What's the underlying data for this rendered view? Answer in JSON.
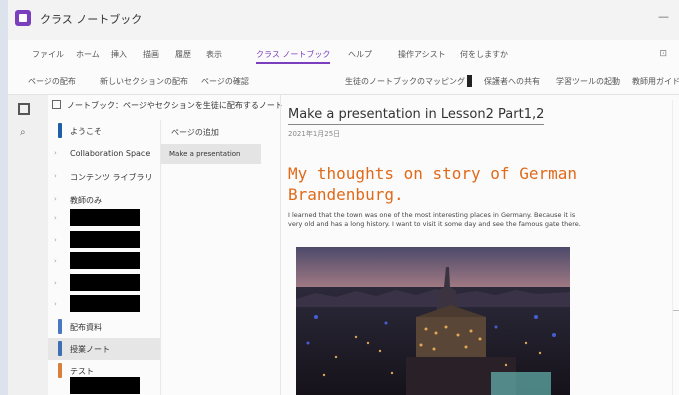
{
  "app": {
    "title": "クラス ノートブック",
    "window_controls": "—"
  },
  "ribbon": {
    "tabs": [
      "ファイル",
      "ホーム",
      "挿入",
      "描画",
      "履歴",
      "表示",
      "クラス ノートブック",
      "ヘルプ",
      "操作アシスト",
      "何をしますか"
    ],
    "active_tab": "クラス ノートブック",
    "right_icon": "⊡"
  },
  "toolbar": {
    "items": [
      "ページの配布",
      "新しいセクションの配布",
      "ページの確認",
      "生徒のノートブックのマッピング",
      "保護者への共有",
      "学習ツールの起動",
      "教師用ガイド"
    ]
  },
  "notebook": {
    "name": "ノートブック：ページやセクションを生徒に配布するノートブック"
  },
  "sections": [
    {
      "label": "ようこそ",
      "color": "#1f5fa8",
      "type": "label"
    },
    {
      "label": "Collaboration Space",
      "color": null,
      "type": "label"
    },
    {
      "label": "コンテンツ ライブラリ",
      "color": null,
      "type": "label"
    },
    {
      "label": "教師のみ",
      "color": null,
      "type": "label"
    },
    {
      "label": "",
      "type": "redacted"
    },
    {
      "label": "",
      "type": "redacted"
    },
    {
      "label": "",
      "type": "redacted"
    },
    {
      "label": "",
      "type": "redacted"
    },
    {
      "label": "",
      "type": "redacted"
    },
    {
      "label": "配布資料",
      "color": "#4a78c0",
      "type": "label"
    },
    {
      "label": "授業ノート",
      "color": "#3d6fb5",
      "type": "label",
      "active": true
    },
    {
      "label": "テスト",
      "color": "#d97f3a",
      "type": "label"
    },
    {
      "label": "",
      "type": "redacted"
    }
  ],
  "pages": {
    "add_page": "ページの追加",
    "items": [
      "Make a presentation"
    ]
  },
  "page": {
    "title": "Make a presentation in Lesson2 Part1,2",
    "date": "2021年1月25日",
    "heading": "My thoughts on story of German Brandenburg.",
    "body": "I learned that the town was one of the most interesting places in Germany. Because it is very old and has a long history. I want to visit it some day and see the famous gate there."
  },
  "colors": {
    "accent": "#7b3fbe",
    "heading": "#e06a1a"
  }
}
